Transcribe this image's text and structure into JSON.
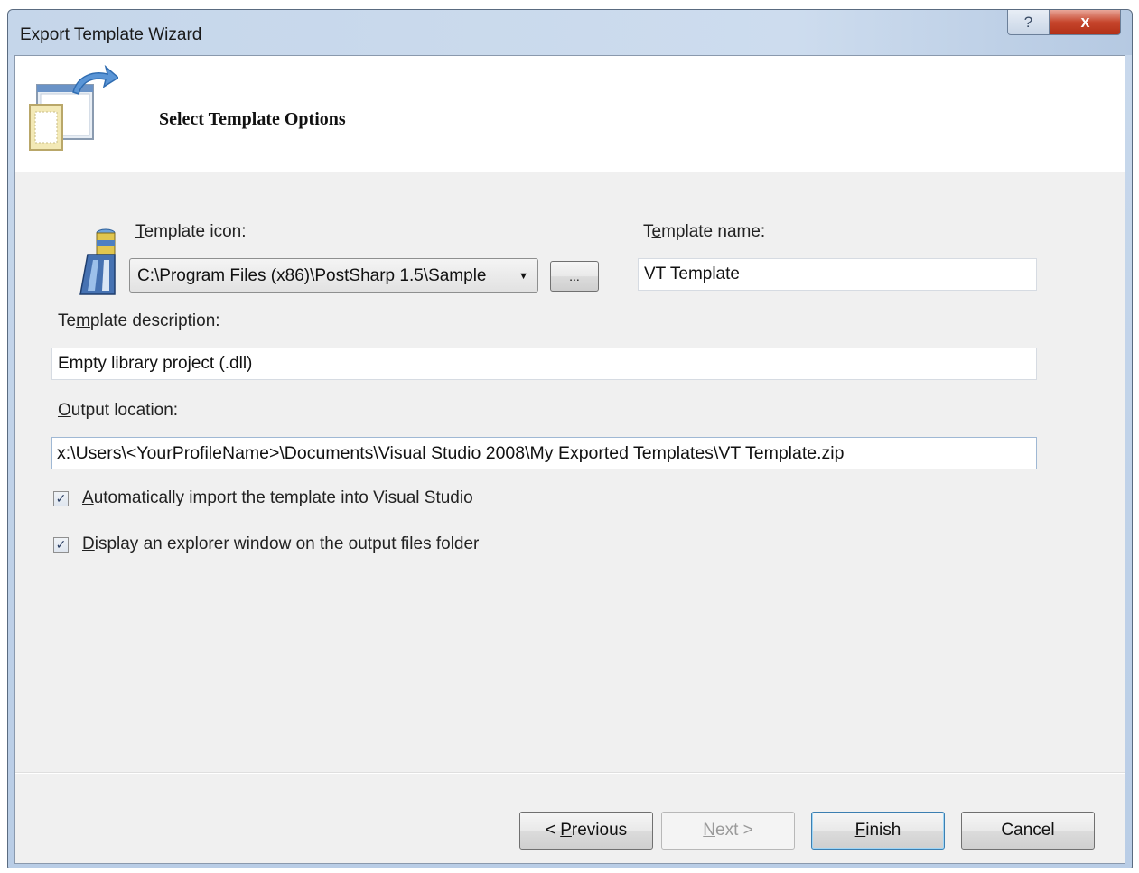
{
  "window": {
    "title": "Export Template Wizard",
    "help_glyph": "?",
    "close_glyph": "x"
  },
  "header": {
    "title": "Select Template Options",
    "icon": "wizard-export-icon"
  },
  "template_icon": {
    "label_underlined": "T",
    "label_rest": "emplate icon:",
    "value": "C:\\Program Files (x86)\\PostSharp 1.5\\Sample",
    "browse_label": "...",
    "icon": "template-preview-icon"
  },
  "template_name": {
    "label_pre": "T",
    "label_underlined": "e",
    "label_rest": "mplate name:",
    "value": "VT Template"
  },
  "template_description": {
    "label_pre": "Te",
    "label_underlined": "m",
    "label_rest": "plate description:",
    "value": "Empty library project (.dll)"
  },
  "output_location": {
    "label_underlined": "O",
    "label_rest": "utput location:",
    "value": "x:\\Users\\<YourProfileName>\\Documents\\Visual Studio 2008\\My Exported Templates\\VT Template.zip"
  },
  "options": [
    {
      "underlined": "A",
      "rest": "utomatically import the template into Visual Studio",
      "checked": true
    },
    {
      "underlined": "D",
      "rest": "isplay an explorer window on the output files folder",
      "checked": true
    }
  ],
  "buttons": {
    "previous": {
      "pre": "< ",
      "underlined": "P",
      "rest": "revious"
    },
    "next": {
      "underlined": "N",
      "rest": "ext >",
      "enabled": false
    },
    "finish": {
      "underlined": "F",
      "rest": "inish"
    },
    "cancel": "Cancel"
  }
}
